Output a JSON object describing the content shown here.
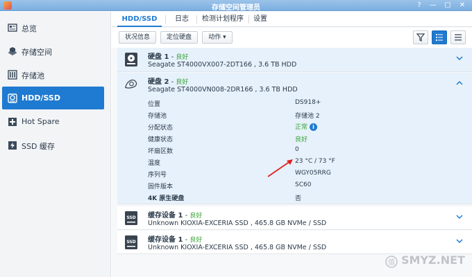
{
  "window": {
    "title": "存储空间管理员",
    "controls": [
      "?",
      "—",
      "▢",
      "✕"
    ]
  },
  "sidebar": {
    "items": [
      {
        "label": "总览",
        "icon": "overview-icon"
      },
      {
        "label": "存储空间",
        "icon": "storage-icon"
      },
      {
        "label": "存储池",
        "icon": "pool-icon"
      },
      {
        "label": "HDD/SSD",
        "icon": "disk-icon",
        "active": true
      },
      {
        "label": "Hot Spare",
        "icon": "hot-spare-icon"
      },
      {
        "label": "SSD 缓存",
        "icon": "ssd-cache-icon"
      }
    ]
  },
  "tabs": [
    {
      "label": "HDD/SSD",
      "active": true
    },
    {
      "label": "日志"
    },
    {
      "label": "检测计划程序"
    },
    {
      "label": "设置"
    }
  ],
  "toolbar": {
    "status_label": "状况信息",
    "locate_label": "定位硬盘",
    "action_label": "动作",
    "action_caret": "▾"
  },
  "disks": [
    {
      "name": "硬盘 1",
      "sep": " - ",
      "status": "良好",
      "model": "Seagate ST4000VX007-2DT166 , 3.6 TB HDD"
    },
    {
      "name": "硬盘 2",
      "sep": " - ",
      "status": "良好",
      "model": "Seagate ST4000VN008-2DR166 , 3.6 TB HDD"
    }
  ],
  "details": [
    {
      "label": "位置",
      "value": "DS918+"
    },
    {
      "label": "存储池",
      "value": "存储池 2"
    },
    {
      "label": "分配状态",
      "value": "正常",
      "green": true,
      "info": true
    },
    {
      "label": "健康状态",
      "value": "良好",
      "green": true
    },
    {
      "label": "坏扇区数",
      "value": "0"
    },
    {
      "label": "温度",
      "value": "23 °C / 73 °F"
    },
    {
      "label": "序列号",
      "value": "WGY05RRG"
    },
    {
      "label": "固件版本",
      "value": "SC60"
    },
    {
      "label": "4K 原生硬盘",
      "value": "否"
    }
  ],
  "caches": [
    {
      "name": "缓存设备 1",
      "sep": " - ",
      "status": "良好",
      "model": "Unknown KIOXIA-EXCERIA SSD , 465.8 GB NVMe / SSD"
    },
    {
      "name": "缓存设备 1",
      "sep": " - ",
      "status": "良好",
      "model": "Unknown KIOXIA-EXCERIA SSD , 465.8 GB NVMe / SSD"
    }
  ],
  "info_glyph": "i",
  "watermark": "SMYZ.NET",
  "colors": {
    "accent": "#1f7ad1",
    "good": "#3aa33a",
    "annotation": "#e02020"
  }
}
